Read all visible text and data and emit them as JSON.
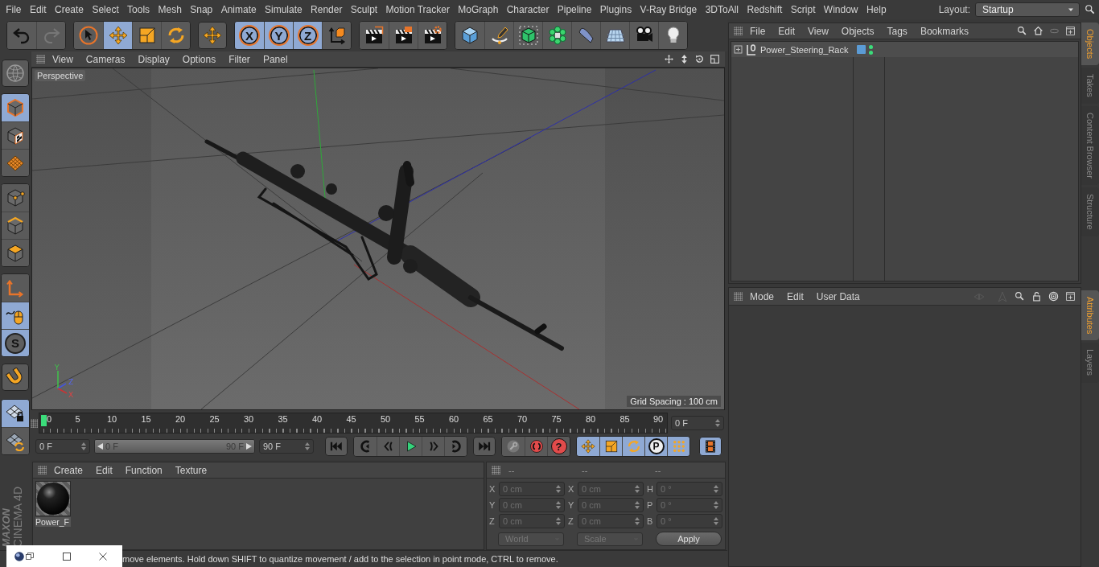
{
  "menu_bar": {
    "items": [
      "File",
      "Edit",
      "Create",
      "Select",
      "Tools",
      "Mesh",
      "Snap",
      "Animate",
      "Simulate",
      "Render",
      "Sculpt",
      "Motion Tracker",
      "MoGraph",
      "Character",
      "Pipeline",
      "Plugins",
      "V-Ray Bridge",
      "3DToAll",
      "Redshift",
      "Script",
      "Window",
      "Help"
    ],
    "layout_label": "Layout:",
    "layout_value": "Startup"
  },
  "toolbar": {
    "groups": [
      [
        {
          "selected": false
        },
        {
          "selected": false
        }
      ],
      [
        {
          "selected": false
        },
        {
          "selected": true
        },
        {
          "selected": false
        },
        {
          "selected": false
        }
      ],
      [
        {
          "selected": false
        }
      ],
      [
        {
          "label": "X",
          "selected": true
        },
        {
          "label": "Y",
          "selected": true
        },
        {
          "label": "Z",
          "selected": true
        },
        {
          "selected": false
        }
      ],
      [
        {
          "selected": false
        },
        {
          "selected": false
        },
        {
          "selected": false
        }
      ],
      [
        {
          "selected": false
        },
        {
          "selected": false
        },
        {
          "selected": false
        },
        {
          "selected": false
        },
        {
          "selected": false
        },
        {
          "selected": false
        },
        {
          "selected": false
        },
        {
          "selected": false
        }
      ]
    ]
  },
  "left_toolbar": {
    "groups": [
      [
        {
          "selected": false
        }
      ],
      [
        {
          "selected": true
        },
        {
          "selected": false
        },
        {
          "selected": false
        }
      ],
      [
        {
          "selected": false
        },
        {
          "selected": false
        },
        {
          "selected": false
        }
      ],
      [
        {
          "selected": false
        },
        {
          "selected": true
        },
        {
          "label": "S",
          "selected": true
        }
      ],
      [
        {
          "selected": false
        }
      ],
      [
        {
          "selected": true
        },
        {
          "selected": false
        }
      ]
    ],
    "logo": {
      "maker": "MAXON",
      "product": "CINEMA 4D"
    }
  },
  "viewport": {
    "menu": [
      "View",
      "Cameras",
      "Display",
      "Options",
      "Filter",
      "Panel"
    ],
    "camera": "Perspective",
    "grid_spacing": "Grid Spacing : 100 cm",
    "axis_labels": [
      "Y",
      "Z",
      "X"
    ]
  },
  "timeline": {
    "frame_labels": [
      "0",
      "5",
      "10",
      "15",
      "20",
      "25",
      "30",
      "35",
      "40",
      "45",
      "50",
      "55",
      "60",
      "65",
      "70",
      "75",
      "80",
      "85",
      "90"
    ],
    "playhead": {
      "level": 0
    },
    "current_frame": "0 F",
    "start_field": "0 F",
    "range": {
      "start": "0 F",
      "end": "90 F",
      "level": 1
    },
    "end_field": "90 F",
    "transport": {
      "groups": [
        [
          {
            "selected": false
          }
        ],
        [
          {
            "selected": false
          },
          {
            "selected": false
          },
          {
            "selected": false
          },
          {
            "selected": false
          },
          {
            "selected": false
          }
        ],
        [
          {
            "selected": false
          }
        ],
        [
          {
            "selected": false
          },
          {
            "selected": false
          },
          {
            "label": "?",
            "selected": false
          }
        ],
        [
          {
            "selected": true
          },
          {
            "selected": true
          },
          {
            "selected": true
          },
          {
            "label": "P",
            "selected": true
          },
          {
            "selected": true
          }
        ],
        [
          {
            "selected": true
          }
        ]
      ]
    }
  },
  "materials": {
    "menu": [
      "Create",
      "Edit",
      "Function",
      "Texture"
    ],
    "items": [
      {
        "name": "Power_F"
      }
    ]
  },
  "coordinates": {
    "headers": [
      "--",
      "--",
      "--"
    ],
    "rows": [
      [
        {
          "axis": "X",
          "value": "0 cm"
        },
        {
          "axis": "X",
          "value": "0 cm"
        },
        {
          "axis": "H",
          "value": "0 °"
        }
      ],
      [
        {
          "axis": "Y",
          "value": "0 cm"
        },
        {
          "axis": "Y",
          "value": "0 cm"
        },
        {
          "axis": "P",
          "value": "0 °"
        }
      ],
      [
        {
          "axis": "Z",
          "value": "0 cm"
        },
        {
          "axis": "Z",
          "value": "0 cm"
        },
        {
          "axis": "B",
          "value": "0 °"
        }
      ]
    ],
    "dropdowns": [
      "World",
      "Scale"
    ],
    "apply": "Apply"
  },
  "object_manager": {
    "menu": [
      "File",
      "Edit",
      "View",
      "Objects",
      "Tags",
      "Bookmarks"
    ],
    "objects": [
      {
        "name": "Power_Steering_Rack",
        "editor_visible": true,
        "render_visible": true
      }
    ]
  },
  "attributes": {
    "menu": [
      "Mode",
      "Edit",
      "User Data"
    ]
  },
  "side_tabs_top": [
    {
      "label": "Objects",
      "selected": true
    },
    {
      "label": "Takes",
      "selected": false
    },
    {
      "label": "Content Browser",
      "selected": false
    },
    {
      "label": "Structure",
      "selected": false
    }
  ],
  "side_tabs_bottom": [
    {
      "label": "Attributes",
      "selected": true
    },
    {
      "label": "Layers",
      "selected": false
    }
  ],
  "status_bar": {
    "text": "move elements. Hold down SHIFT to quantize movement / add to the selection in point mode, CTRL to remove."
  }
}
